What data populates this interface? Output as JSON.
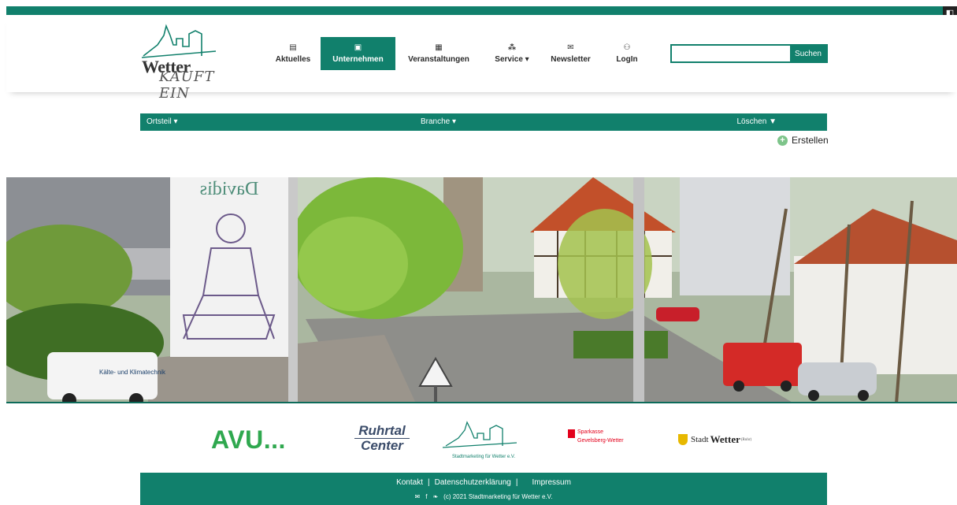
{
  "logo": {
    "line1": "Wetter",
    "line2": "KAUFT EIN"
  },
  "nav": {
    "items": [
      {
        "label": "Aktuelles",
        "icon": "newspaper-icon",
        "glyph": "▤"
      },
      {
        "label": "Unternehmen",
        "icon": "store-icon",
        "glyph": "▣",
        "active": true
      },
      {
        "label": "Veranstaltungen",
        "icon": "calendar-icon",
        "glyph": "▦"
      },
      {
        "label": "Service ▾",
        "icon": "sitemap-icon",
        "glyph": "⁂"
      },
      {
        "label": "Newsletter",
        "icon": "envelope-open-icon",
        "glyph": "✉"
      },
      {
        "label": "LogIn",
        "icon": "users-icon",
        "glyph": "⚇"
      }
    ]
  },
  "search": {
    "value": "",
    "placeholder": "",
    "button_label": "Suchen"
  },
  "filters": {
    "ortsteil_label": "Ortsteil ▾",
    "branche_label": "Branche ▾",
    "loeschen_label": "Löschen",
    "erstellen_label": "Erstellen"
  },
  "hero": {
    "banner_text": "Davidis",
    "van_text": "Kälte- und Klimatechnik"
  },
  "sponsors": {
    "avu": "AVU...",
    "ruhrtal_line1": "Ruhrtal",
    "ruhrtal_line2": "Center",
    "stadtmarketing": "Stadtmarketing für Wetter e.V.",
    "sparkasse_line1": "Sparkasse",
    "sparkasse_line2": "Gevelsberg-Wetter",
    "stadt_prefix": "Stadt",
    "stadt_name": "Wetter",
    "stadt_suffix": "(Ruhr)"
  },
  "footer": {
    "links": [
      "Kontakt",
      "Datenschutzerklärung",
      "Impressum"
    ],
    "separator": "|",
    "copyright": "(c) 2021 Stadtmarketing für Wetter e.V."
  },
  "colors": {
    "brand": "#11806c",
    "sparkasse": "#e3001b",
    "avu": "#2fa84f"
  }
}
